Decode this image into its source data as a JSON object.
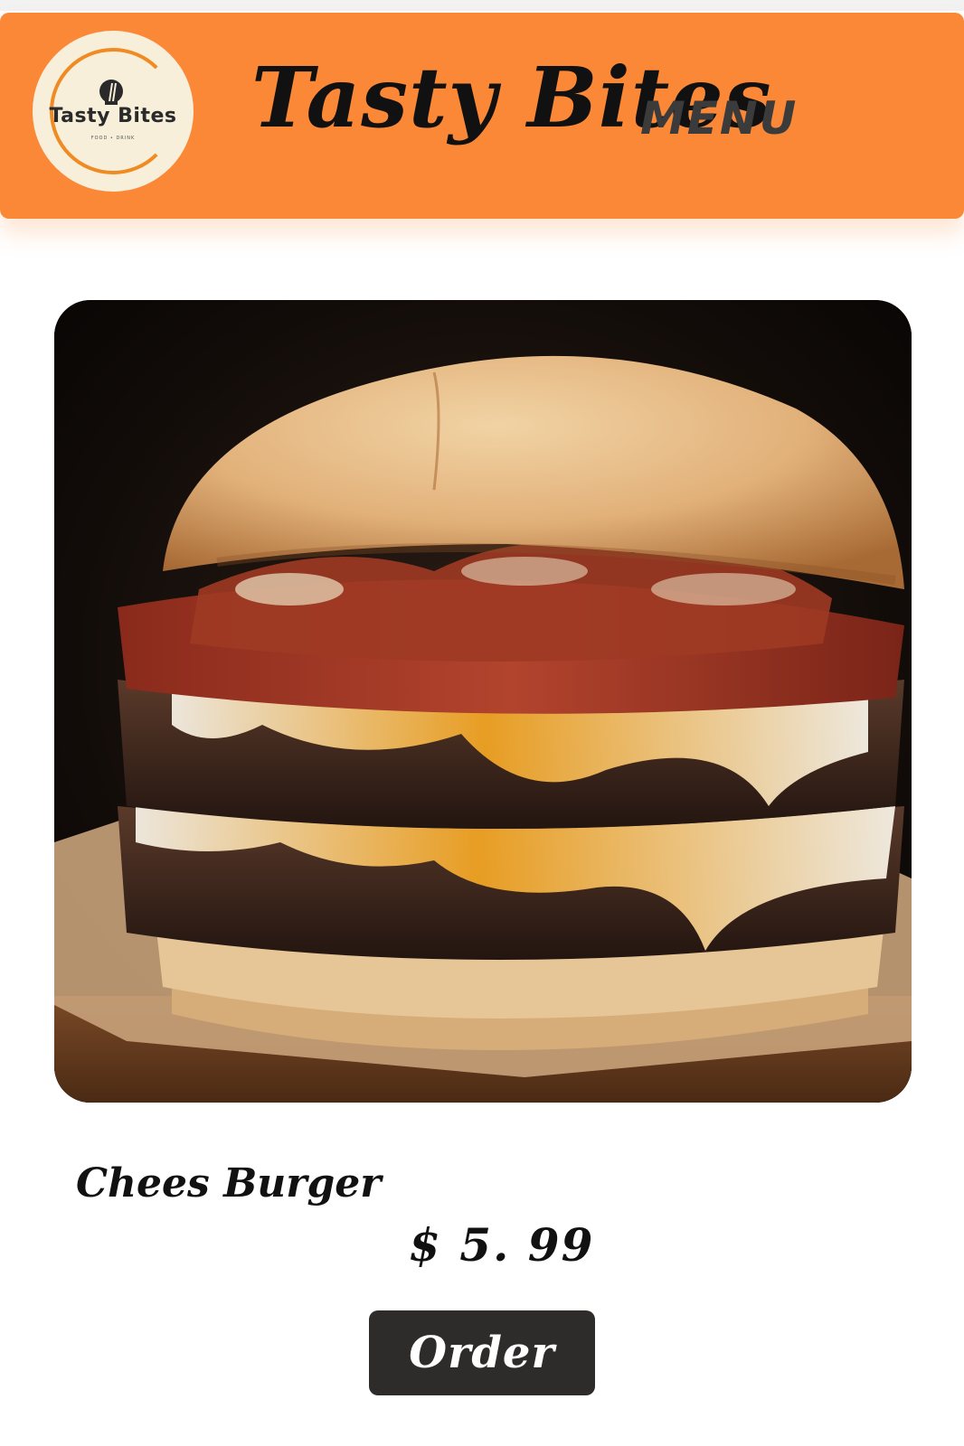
{
  "header": {
    "logo": {
      "name": "Tasty Bites",
      "tagline": "FOOD • DRINK",
      "icon": "chef-hat-icon"
    },
    "brand_title": "Tasty Bites",
    "menu_label": "MENU"
  },
  "item": {
    "image": "cheese-burger-photo",
    "name": "Chees Burger",
    "price": "$ 5. 99",
    "order_label": "Order"
  },
  "colors": {
    "header_bg": "#fb8836",
    "button_bg": "#2e2b2b",
    "text": "#111111"
  }
}
